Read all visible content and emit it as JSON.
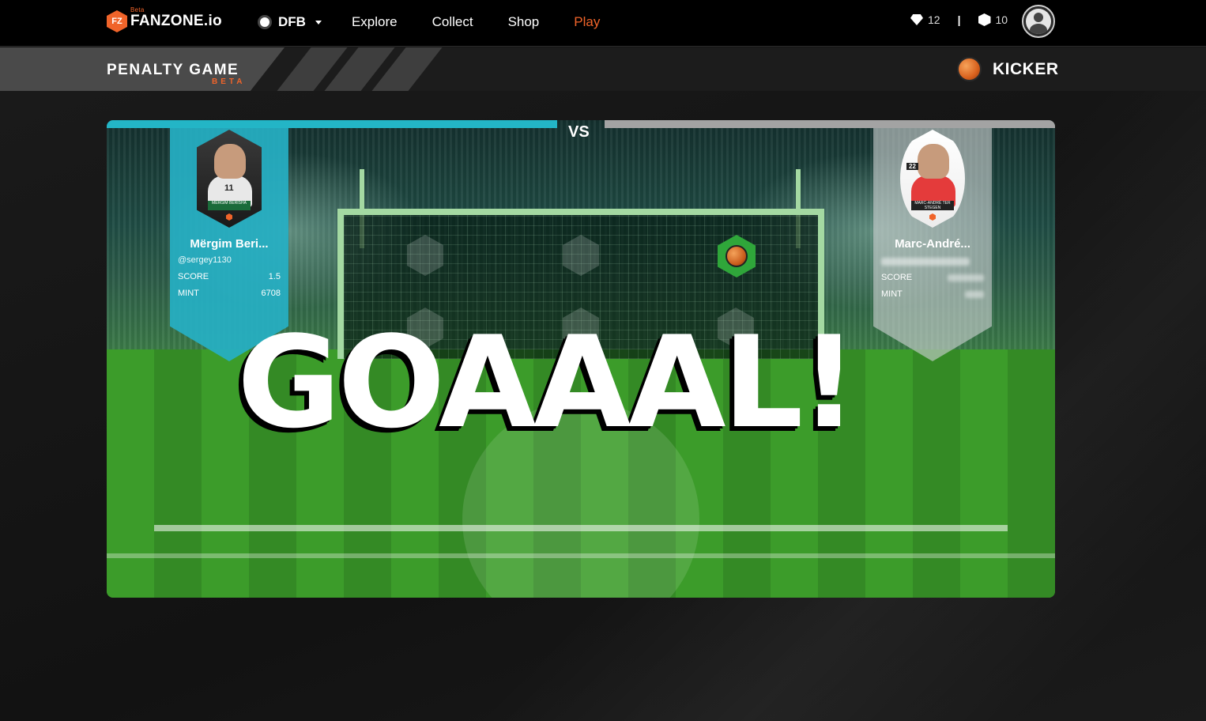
{
  "brand": {
    "name": "FANZONE.io",
    "beta": "Beta",
    "badge": "FZ",
    "accent": "#f0642a"
  },
  "nav": {
    "club": "DFB",
    "links": [
      "Explore",
      "Collect",
      "Shop",
      "Play"
    ],
    "active": "Play"
  },
  "stats": {
    "gems": "12",
    "coins": "10",
    "separator": "|"
  },
  "header": {
    "title": "PENALTY GAME",
    "beta": "BETA",
    "role": "KICKER"
  },
  "game": {
    "vs": "VS",
    "result": "GOAAAL!",
    "left_player": {
      "name": "Mërgim Beri...",
      "user": "@sergey1130",
      "score_label": "SCORE",
      "score": "1.5",
      "mint_label": "MINT",
      "mint": "6708",
      "card_number": "11",
      "card_name": "MËRGIM BERISHA",
      "color": "#26b0c4"
    },
    "right_player": {
      "name": "Marc-André...",
      "score_label": "SCORE",
      "mint_label": "MINT",
      "card_number": "22",
      "card_name": "MARC-ANDRÉ TER STEGEN",
      "color": "#cdd2d2"
    }
  }
}
